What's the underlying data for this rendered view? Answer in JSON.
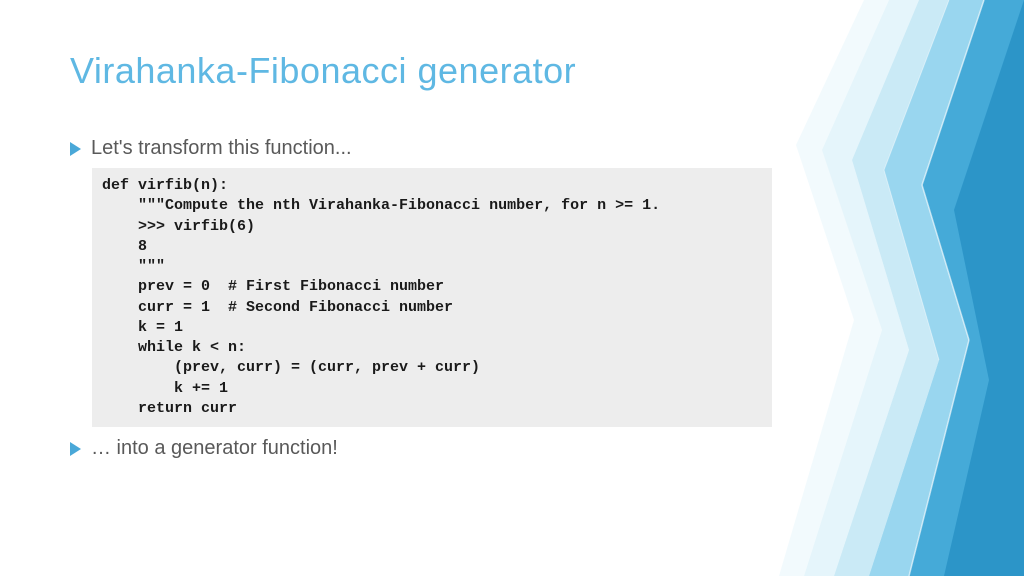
{
  "title": "Virahanka-Fibonacci generator",
  "bullets": {
    "first": "Let's transform this function...",
    "second": "… into a generator function!"
  },
  "code": "def virfib(n):\n    \"\"\"Compute the nth Virahanka-Fibonacci number, for n >= 1.\n    >>> virfib(6)\n    8\n    \"\"\"\n    prev = 0  # First Fibonacci number\n    curr = 1  # Second Fibonacci number\n    k = 1\n    while k < n:\n        (prev, curr) = (curr, prev + curr)\n        k += 1\n    return curr",
  "colors": {
    "titleColor": "#5fb8e3",
    "bulletColor": "#4aa8d8",
    "textColor": "#595959",
    "codeBackground": "#ededed"
  }
}
